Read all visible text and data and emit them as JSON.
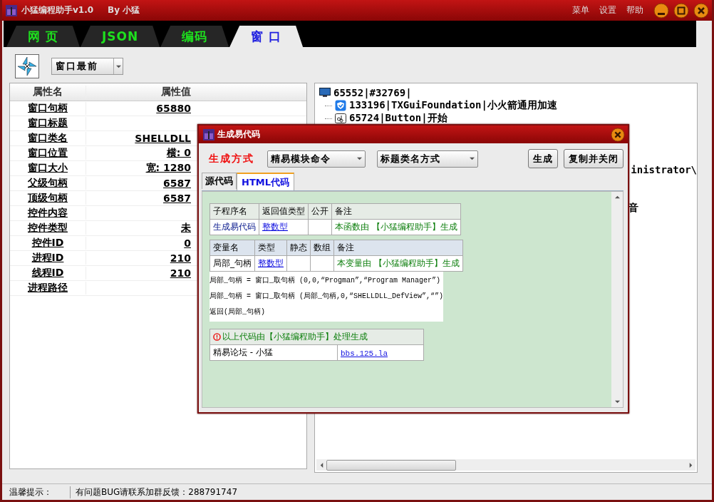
{
  "window": {
    "title": "小猛编程助手v1.0",
    "author": "By 小猛",
    "menu": [
      "菜单",
      "设置",
      "帮助"
    ]
  },
  "tabs": [
    {
      "label": "网 页",
      "selected": false
    },
    {
      "label": "JSON",
      "selected": false
    },
    {
      "label": "编码",
      "selected": false
    },
    {
      "label": "窗 口",
      "selected": true
    }
  ],
  "toolbar": {
    "dropdown": "窗口最前"
  },
  "properties": {
    "columns": [
      "属性名",
      "属性值"
    ],
    "rows": [
      {
        "name": "窗口句柄",
        "value": "65880"
      },
      {
        "name": "窗口标题"
      },
      {
        "name": "窗口类名",
        "value": "SHELLDLL"
      },
      {
        "name": "窗口位置",
        "value": "横: 0"
      },
      {
        "name": "窗口大小",
        "value": "宽: 1280"
      },
      {
        "name": "父级句柄",
        "value": "6587"
      },
      {
        "name": "顶级句柄",
        "value": "6587"
      },
      {
        "name": "控件内容"
      },
      {
        "name": "控件类型",
        "value": "未"
      },
      {
        "name": "控件ID",
        "value": "0"
      },
      {
        "name": "进程ID",
        "value": "210"
      },
      {
        "name": "线程ID",
        "value": "210"
      },
      {
        "name": "进程路径"
      }
    ]
  },
  "tree": {
    "items": [
      {
        "kind": "desktop",
        "label": "65552|#32769|",
        "children": [
          {
            "kind": "shield",
            "label": "133196|TXGuiFoundation|小火箭通用加速"
          },
          {
            "kind": "textbutton",
            "label": "65724|Button|开始"
          }
        ]
      }
    ],
    "partial_lines": [
      "inistrator\\",
      "音"
    ]
  },
  "dialog": {
    "title": "生成易代码",
    "method_label": "生成方式",
    "dropdowns": [
      "精易模块命令",
      "标题类名方式"
    ],
    "buttons": [
      "生成",
      "复制并关闭"
    ],
    "tabs": [
      {
        "label": "源代码",
        "selected": false
      },
      {
        "label": "HTML代码",
        "selected": true
      }
    ],
    "sub_table": {
      "columns": [
        "子程序名",
        "返回值类型",
        "公开",
        "备注"
      ],
      "cells": [
        {
          "kind": "name",
          "text": "生成易代码"
        },
        {
          "kind": "type",
          "text": "整数型"
        },
        {
          "kind": "empty"
        },
        {
          "kind": "note",
          "text": "本函数由 【小猛编程助手】生成"
        }
      ]
    },
    "var_table": {
      "columns": [
        "变量名",
        "类型",
        "静态",
        "数组",
        "备注"
      ],
      "cells": [
        {
          "kind": "plain",
          "text": "局部_句柄"
        },
        {
          "kind": "type",
          "text": "整数型"
        },
        {
          "kind": "empty"
        },
        {
          "kind": "empty"
        },
        {
          "kind": "note",
          "text": "本变量由 【小猛编程助手】生成"
        }
      ]
    },
    "code_lines": [
      "局部_句柄 = 窗口_取句柄 (0,0,“Progman”,“Program Manager”)",
      "局部_句柄 = 窗口_取句柄 (局部_句柄,0,“SHELLDLL_DefView”,“”)",
      "返回(局部_句柄)"
    ],
    "footer": {
      "notice": "以上代码由【小猛编程助手】处理生成",
      "credit": "精易论坛 - 小猛",
      "link": "bbs.125.la"
    }
  },
  "status_bar": {
    "label": "温馨提示：",
    "message": "有问题BUG请联系加群反馈：288791747"
  }
}
